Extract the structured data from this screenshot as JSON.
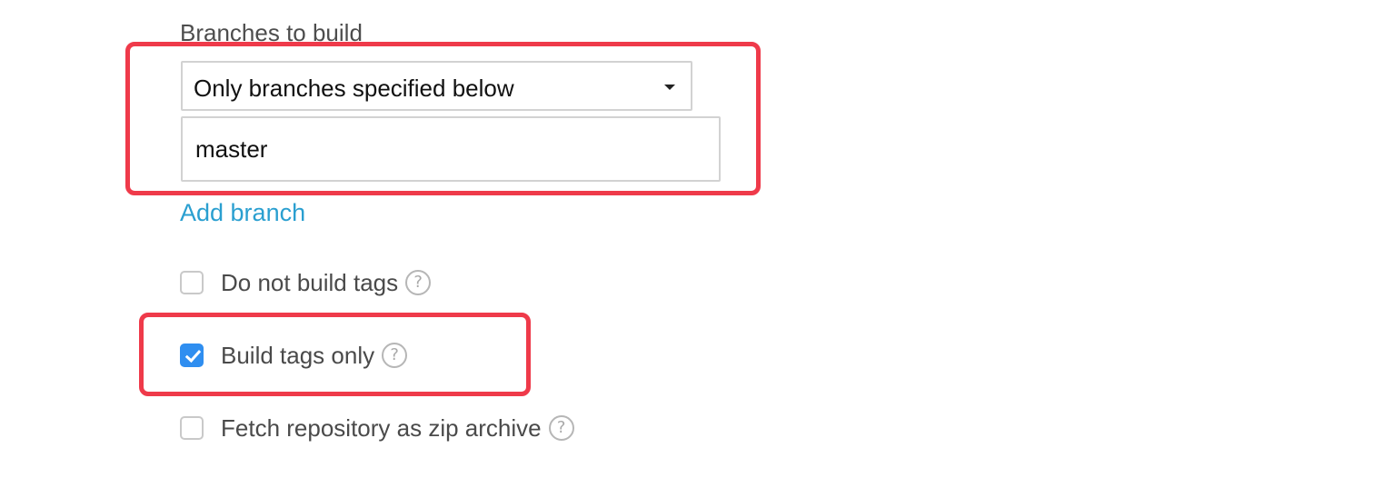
{
  "branches": {
    "label": "Branches to build",
    "select_value": "Only branches specified below",
    "branch_input_value": "master",
    "add_branch_label": "Add branch"
  },
  "options": [
    {
      "label": "Do not build tags",
      "checked": false,
      "help": "?"
    },
    {
      "label": "Build tags only",
      "checked": true,
      "help": "?"
    },
    {
      "label": "Fetch repository as zip archive",
      "checked": false,
      "help": "?"
    }
  ],
  "colors": {
    "highlight": "#ef3a4a",
    "link": "#2a9fd0",
    "checkbox_checked": "#2f8ef0"
  },
  "icons": {
    "dropdown": "caret-down-icon",
    "help": "question-mark-icon",
    "checkmark": "checkmark-icon"
  }
}
